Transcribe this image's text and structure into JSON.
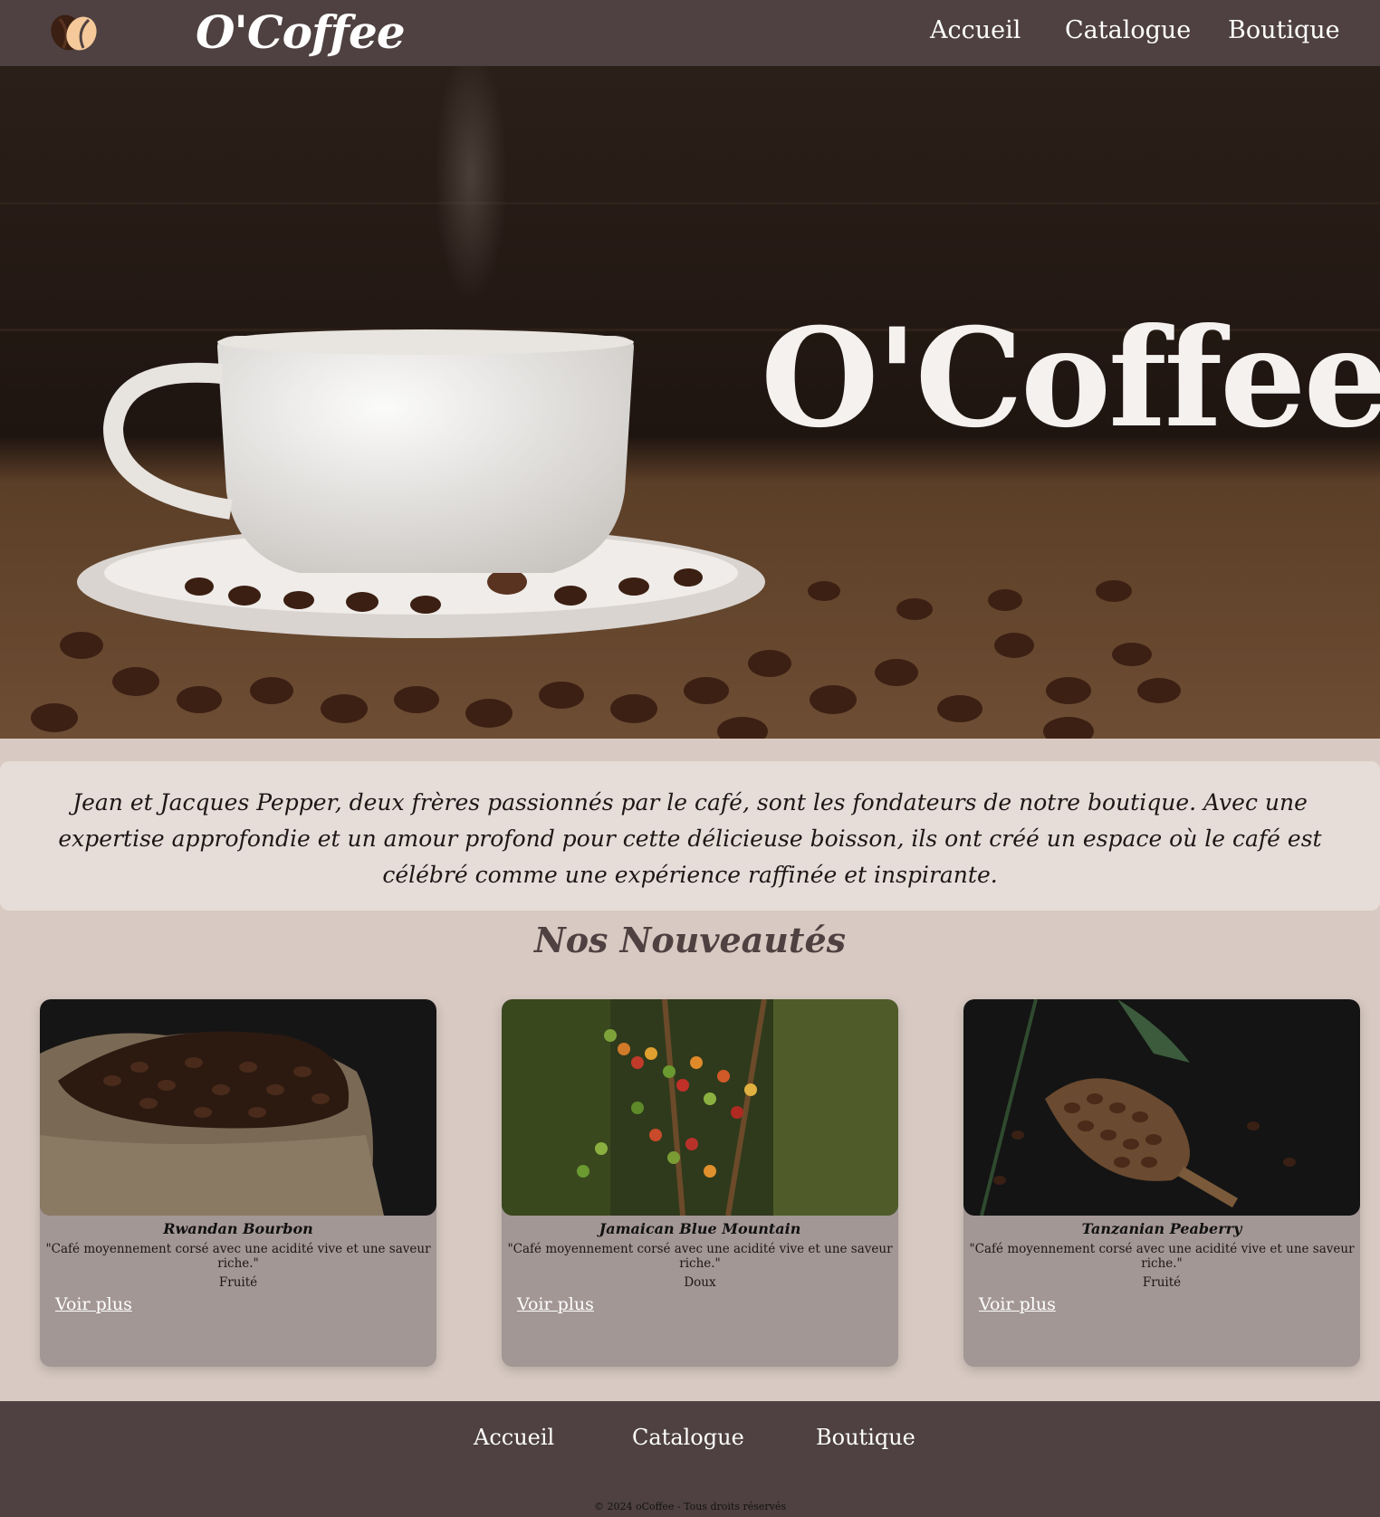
{
  "header": {
    "logo_icon": "coffee-bean-icon",
    "brand": "O'Coffee",
    "nav": [
      "Accueil",
      "Catalogue",
      "Boutique"
    ]
  },
  "hero": {
    "title": "O'Coffee",
    "image": "coffee-cup-with-beans-photo"
  },
  "intro": {
    "text": "Jean et Jacques Pepper, deux frères passionnés par le café, sont les fondateurs de notre boutique. Avec une expertise approfondie et un amour profond pour cette délicieuse boisson, ils ont créé un espace où le café est célébré comme une expérience raffinée et inspirante."
  },
  "section": {
    "title": "Nos Nouveautés"
  },
  "products": [
    {
      "name": "Rwandan Bourbon",
      "description": "\"Café moyennement corsé avec une acidité vive et une saveur riche.\"",
      "tag": "Fruité",
      "link": "Voir plus",
      "image": "coffee-bag-photo"
    },
    {
      "name": "Jamaican Blue Mountain",
      "description": "\"Café moyennement corsé avec une acidité vive et une saveur riche.\"",
      "tag": "Doux",
      "link": "Voir plus",
      "image": "coffee-cherries-photo"
    },
    {
      "name": "Tanzanian Peaberry",
      "description": "\"Café moyennement corsé avec une acidité vive et une saveur riche.\"",
      "tag": "Fruité",
      "link": "Voir plus",
      "image": "coffee-scoop-photo"
    }
  ],
  "footer": {
    "nav": [
      "Accueil",
      "Catalogue",
      "Boutique"
    ],
    "copyright": "© 2024 oCoffee - Tous droits réservés"
  },
  "colors": {
    "header_bg": "#4f4141",
    "page_bg": "#d8cac2",
    "intro_bg": "#e6ddd8",
    "card_bg": "#a39795",
    "accent_bean": "#f5c99a"
  }
}
